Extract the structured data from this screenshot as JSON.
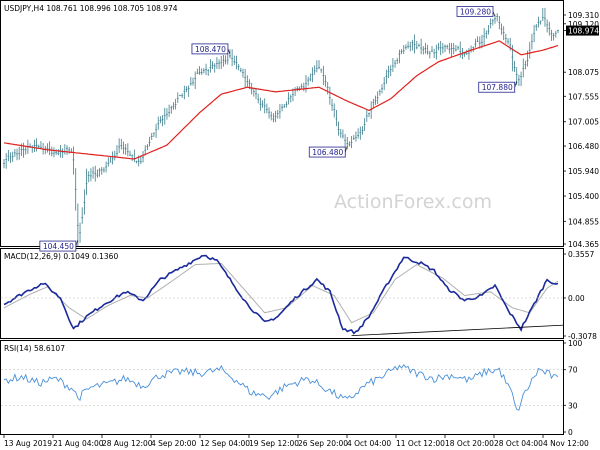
{
  "colors": {
    "candle": "#3a7d8c",
    "ma": "#e0201d",
    "macd_line": "#1a2a9a",
    "macd_signal": "#b0b0b0",
    "rsi": "#4a90d9",
    "label_border": "#23238e",
    "label_text": "#23238e",
    "axis": "#000000",
    "watermark": "#d3d3d3"
  },
  "main": {
    "header": "USDJPY,H4  108.761 108.996 108.705 108.974",
    "watermark": "ActionForex.com",
    "price_axis_labels": [
      "109.310",
      "109.120",
      "108.974",
      "108.075",
      "107.555",
      "107.005",
      "106.480",
      "105.940",
      "105.400",
      "104.855",
      "104.365"
    ],
    "current_price": "108.974",
    "annotations": [
      "108.470",
      "109.280",
      "106.480",
      "107.880",
      "104.450"
    ]
  },
  "macd": {
    "header": "MACD(12,26,9) 0.1049 0.1360",
    "axis_labels": [
      "0.3557",
      "0.00",
      "-0.3078"
    ]
  },
  "rsi": {
    "header": "RSI(14) 58.6107",
    "axis_labels": [
      "100",
      "70",
      "30",
      "0"
    ]
  },
  "time_axis": [
    "13 Aug 2019",
    "21 Aug 04:00",
    "28 Aug 12:00",
    "4 Sep 20:00",
    "12 Sep 04:00",
    "19 Sep 12:00",
    "26 Sep 20:00",
    "4 Oct 04:00",
    "11 Oct 12:00",
    "18 Oct 20:00",
    "28 Oct 04:00",
    "4 Nov 12:00"
  ],
  "chart_data": [
    {
      "type": "candlestick",
      "title": "USDJPY,H4",
      "ylim": [
        104.365,
        109.31
      ],
      "header_values": {
        "open": 108.761,
        "high": 108.996,
        "low": 108.705,
        "close": 108.974
      },
      "x": [
        "13 Aug 2019",
        "21 Aug 04:00",
        "28 Aug 12:00",
        "4 Sep 20:00",
        "12 Sep 04:00",
        "19 Sep 12:00",
        "26 Sep 20:00",
        "4 Oct 04:00",
        "11 Oct 12:00",
        "18 Oct 20:00",
        "28 Oct 04:00",
        "4 Nov 12:00"
      ],
      "key_points": [
        {
          "x": 0,
          "y": 106.2
        },
        {
          "x": 14,
          "y": 106.5
        },
        {
          "x": 24,
          "y": 106.3
        },
        {
          "x": 31,
          "y": 106.4
        },
        {
          "x": 32,
          "y": 105.9
        },
        {
          "x": 34,
          "y": 104.45
        },
        {
          "x": 38,
          "y": 105.8
        },
        {
          "x": 46,
          "y": 106.0
        },
        {
          "x": 54,
          "y": 106.5
        },
        {
          "x": 62,
          "y": 106.1
        },
        {
          "x": 70,
          "y": 106.9
        },
        {
          "x": 80,
          "y": 107.5
        },
        {
          "x": 90,
          "y": 108.1
        },
        {
          "x": 98,
          "y": 108.2
        },
        {
          "x": 104,
          "y": 108.47
        },
        {
          "x": 110,
          "y": 108.0
        },
        {
          "x": 118,
          "y": 107.4
        },
        {
          "x": 124,
          "y": 107.05
        },
        {
          "x": 132,
          "y": 107.6
        },
        {
          "x": 140,
          "y": 107.9
        },
        {
          "x": 144,
          "y": 108.2
        },
        {
          "x": 148,
          "y": 107.8
        },
        {
          "x": 154,
          "y": 106.8
        },
        {
          "x": 158,
          "y": 106.48
        },
        {
          "x": 164,
          "y": 106.8
        },
        {
          "x": 170,
          "y": 107.4
        },
        {
          "x": 176,
          "y": 108.0
        },
        {
          "x": 182,
          "y": 108.5
        },
        {
          "x": 188,
          "y": 108.7
        },
        {
          "x": 196,
          "y": 108.5
        },
        {
          "x": 204,
          "y": 108.6
        },
        {
          "x": 212,
          "y": 108.5
        },
        {
          "x": 220,
          "y": 108.8
        },
        {
          "x": 226,
          "y": 109.28
        },
        {
          "x": 232,
          "y": 108.7
        },
        {
          "x": 236,
          "y": 107.88
        },
        {
          "x": 240,
          "y": 108.3
        },
        {
          "x": 244,
          "y": 109.0
        },
        {
          "x": 248,
          "y": 109.31
        },
        {
          "x": 252,
          "y": 108.9
        },
        {
          "x": 255,
          "y": 108.974
        }
      ],
      "ma_points": [
        {
          "x": 0,
          "y": 106.55
        },
        {
          "x": 20,
          "y": 106.4
        },
        {
          "x": 40,
          "y": 106.3
        },
        {
          "x": 60,
          "y": 106.2
        },
        {
          "x": 75,
          "y": 106.5
        },
        {
          "x": 90,
          "y": 107.2
        },
        {
          "x": 100,
          "y": 107.6
        },
        {
          "x": 112,
          "y": 107.75
        },
        {
          "x": 125,
          "y": 107.65
        },
        {
          "x": 135,
          "y": 107.7
        },
        {
          "x": 145,
          "y": 107.75
        },
        {
          "x": 158,
          "y": 107.45
        },
        {
          "x": 168,
          "y": 107.25
        },
        {
          "x": 178,
          "y": 107.5
        },
        {
          "x": 190,
          "y": 108.0
        },
        {
          "x": 200,
          "y": 108.3
        },
        {
          "x": 215,
          "y": 108.55
        },
        {
          "x": 228,
          "y": 108.75
        },
        {
          "x": 238,
          "y": 108.45
        },
        {
          "x": 248,
          "y": 108.55
        },
        {
          "x": 255,
          "y": 108.65
        }
      ]
    },
    {
      "type": "line",
      "title": "MACD(12,26,9)",
      "ylim": [
        -0.3078,
        0.3557
      ],
      "series": [
        {
          "name": "MACD",
          "key_points": [
            {
              "x": 0,
              "y": -0.05
            },
            {
              "x": 10,
              "y": 0.05
            },
            {
              "x": 18,
              "y": 0.12
            },
            {
              "x": 26,
              "y": 0.0
            },
            {
              "x": 32,
              "y": -0.25
            },
            {
              "x": 38,
              "y": -0.15
            },
            {
              "x": 46,
              "y": -0.05
            },
            {
              "x": 56,
              "y": 0.05
            },
            {
              "x": 64,
              "y": -0.02
            },
            {
              "x": 72,
              "y": 0.15
            },
            {
              "x": 82,
              "y": 0.25
            },
            {
              "x": 92,
              "y": 0.35
            },
            {
              "x": 98,
              "y": 0.3
            },
            {
              "x": 104,
              "y": 0.15
            },
            {
              "x": 112,
              "y": -0.05
            },
            {
              "x": 120,
              "y": -0.2
            },
            {
              "x": 126,
              "y": -0.15
            },
            {
              "x": 134,
              "y": 0.0
            },
            {
              "x": 144,
              "y": 0.15
            },
            {
              "x": 150,
              "y": 0.05
            },
            {
              "x": 156,
              "y": -0.25
            },
            {
              "x": 162,
              "y": -0.28
            },
            {
              "x": 168,
              "y": -0.15
            },
            {
              "x": 176,
              "y": 0.1
            },
            {
              "x": 184,
              "y": 0.33
            },
            {
              "x": 192,
              "y": 0.28
            },
            {
              "x": 198,
              "y": 0.22
            },
            {
              "x": 204,
              "y": 0.08
            },
            {
              "x": 212,
              "y": -0.02
            },
            {
              "x": 220,
              "y": 0.02
            },
            {
              "x": 226,
              "y": 0.1
            },
            {
              "x": 232,
              "y": -0.1
            },
            {
              "x": 238,
              "y": -0.25
            },
            {
              "x": 244,
              "y": -0.05
            },
            {
              "x": 250,
              "y": 0.15
            },
            {
              "x": 255,
              "y": 0.1049
            }
          ]
        },
        {
          "name": "Signal",
          "key_points": [
            {
              "x": 0,
              "y": -0.08
            },
            {
              "x": 12,
              "y": 0.03
            },
            {
              "x": 20,
              "y": 0.09
            },
            {
              "x": 30,
              "y": -0.08
            },
            {
              "x": 38,
              "y": -0.17
            },
            {
              "x": 48,
              "y": -0.06
            },
            {
              "x": 58,
              "y": 0.02
            },
            {
              "x": 66,
              "y": 0.0
            },
            {
              "x": 76,
              "y": 0.12
            },
            {
              "x": 88,
              "y": 0.27
            },
            {
              "x": 100,
              "y": 0.28
            },
            {
              "x": 110,
              "y": 0.08
            },
            {
              "x": 120,
              "y": -0.12
            },
            {
              "x": 130,
              "y": -0.08
            },
            {
              "x": 142,
              "y": 0.1
            },
            {
              "x": 152,
              "y": 0.02
            },
            {
              "x": 160,
              "y": -0.2
            },
            {
              "x": 170,
              "y": -0.12
            },
            {
              "x": 180,
              "y": 0.15
            },
            {
              "x": 190,
              "y": 0.27
            },
            {
              "x": 202,
              "y": 0.16
            },
            {
              "x": 212,
              "y": 0.02
            },
            {
              "x": 224,
              "y": 0.05
            },
            {
              "x": 234,
              "y": -0.08
            },
            {
              "x": 242,
              "y": -0.12
            },
            {
              "x": 250,
              "y": 0.08
            },
            {
              "x": 255,
              "y": 0.136
            }
          ]
        }
      ],
      "trendline": [
        {
          "x": 160,
          "y": -0.305
        },
        {
          "x": 255,
          "y": -0.22
        }
      ]
    },
    {
      "type": "line",
      "title": "RSI(14)",
      "ylim": [
        0,
        100
      ],
      "series": [
        {
          "name": "RSI",
          "key_points": [
            {
              "x": 0,
              "y": 58
            },
            {
              "x": 8,
              "y": 62
            },
            {
              "x": 16,
              "y": 55
            },
            {
              "x": 24,
              "y": 60
            },
            {
              "x": 32,
              "y": 48
            },
            {
              "x": 34,
              "y": 38
            },
            {
              "x": 40,
              "y": 50
            },
            {
              "x": 48,
              "y": 54
            },
            {
              "x": 56,
              "y": 60
            },
            {
              "x": 64,
              "y": 52
            },
            {
              "x": 72,
              "y": 64
            },
            {
              "x": 82,
              "y": 68
            },
            {
              "x": 90,
              "y": 66
            },
            {
              "x": 100,
              "y": 70
            },
            {
              "x": 106,
              "y": 60
            },
            {
              "x": 114,
              "y": 44
            },
            {
              "x": 122,
              "y": 40
            },
            {
              "x": 130,
              "y": 52
            },
            {
              "x": 140,
              "y": 60
            },
            {
              "x": 146,
              "y": 52
            },
            {
              "x": 154,
              "y": 40
            },
            {
              "x": 158,
              "y": 35
            },
            {
              "x": 166,
              "y": 52
            },
            {
              "x": 174,
              "y": 62
            },
            {
              "x": 182,
              "y": 74
            },
            {
              "x": 190,
              "y": 66
            },
            {
              "x": 198,
              "y": 60
            },
            {
              "x": 206,
              "y": 64
            },
            {
              "x": 214,
              "y": 58
            },
            {
              "x": 222,
              "y": 68
            },
            {
              "x": 228,
              "y": 70
            },
            {
              "x": 234,
              "y": 42
            },
            {
              "x": 236,
              "y": 22
            },
            {
              "x": 240,
              "y": 45
            },
            {
              "x": 246,
              "y": 70
            },
            {
              "x": 250,
              "y": 66
            },
            {
              "x": 255,
              "y": 58.61
            }
          ]
        }
      ],
      "levels": [
        70,
        30
      ]
    }
  ]
}
